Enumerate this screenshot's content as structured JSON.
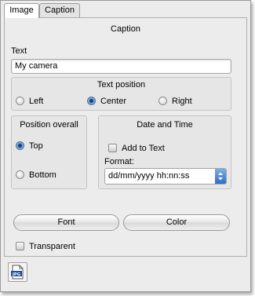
{
  "tabs": [
    {
      "label": "Image",
      "active": true
    },
    {
      "label": "Caption",
      "active": false
    }
  ],
  "caption_section": {
    "title": "Caption",
    "text_label": "Text",
    "text_value": "My camera"
  },
  "text_position": {
    "title": "Text position",
    "options": [
      "Left",
      "Center",
      "Right"
    ],
    "selected": "Center"
  },
  "position_overall": {
    "title": "Position overall",
    "options": [
      "Top",
      "Bottom"
    ],
    "selected": "Top"
  },
  "date_time": {
    "title": "Date and Time",
    "add_to_text_label": "Add to Text",
    "add_to_text_checked": false,
    "format_label": "Format:",
    "format_value": "dd/mm/yyyy hh:nn:ss"
  },
  "buttons": {
    "font": "Font",
    "color": "Color"
  },
  "transparent": {
    "label": "Transparent",
    "checked": false
  },
  "icons": {
    "jpg_button": "jpg-file-icon",
    "jpg_text": "JPG"
  },
  "colors": {
    "radio_selected": "#6d9fd6",
    "select_arrow": "#2f6cc8"
  }
}
